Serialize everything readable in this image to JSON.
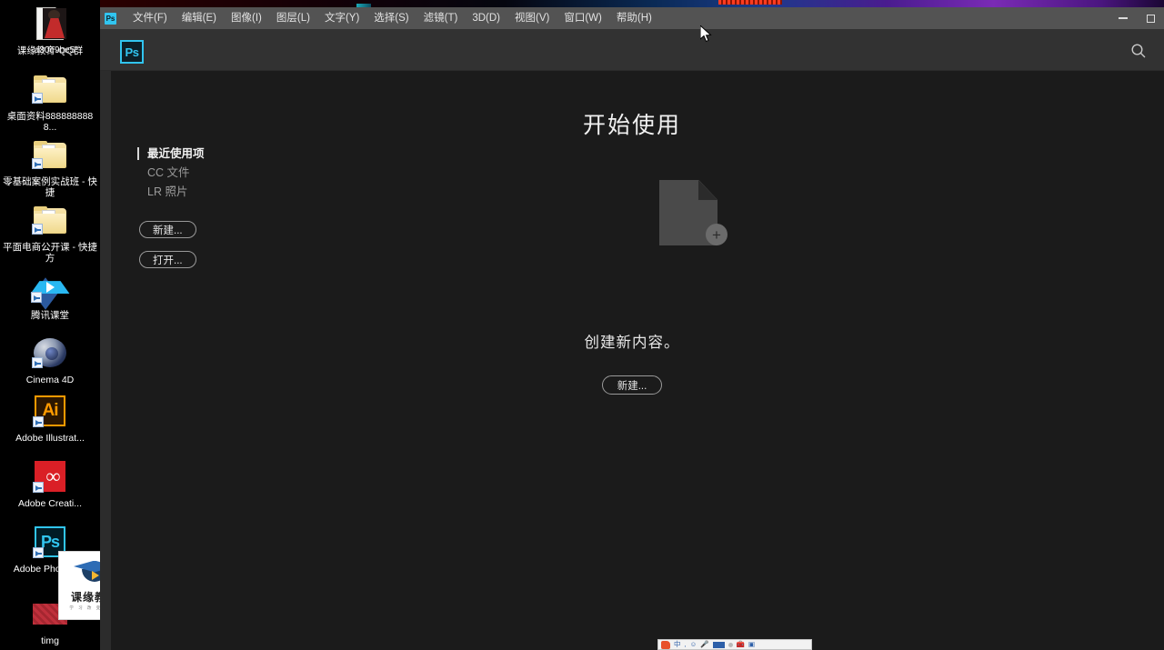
{
  "desktop": {
    "icons": [
      {
        "label": "课缘教育-QQ群",
        "icon": "document-icon",
        "shortcut": false
      },
      {
        "label": "a30e9be5",
        "icon": "photo-thumbnail-icon",
        "shortcut": false
      },
      {
        "label": "桌面资料8888888888...",
        "icon": "folder-icon",
        "shortcut": true
      },
      {
        "label": "零基础案例实战班 - 快捷",
        "icon": "folder-icon",
        "shortcut": true
      },
      {
        "label": "平面电商公开课 - 快捷方",
        "icon": "folder-icon",
        "shortcut": true
      },
      {
        "label": "腾讯课堂",
        "icon": "tencent-classroom-icon",
        "shortcut": true
      },
      {
        "label": "Cinema 4D",
        "icon": "cinema4d-icon",
        "shortcut": true
      },
      {
        "label": "Adobe Illustrat...",
        "icon": "adobe-illustrator-icon",
        "shortcut": true
      },
      {
        "label": "Adobe Creati...",
        "icon": "adobe-creative-cloud-icon",
        "shortcut": true
      },
      {
        "label": "Adobe Photosh...",
        "icon": "adobe-photoshop-icon",
        "shortcut": true
      },
      {
        "label": "timg",
        "icon": "image-thumbnail-icon",
        "shortcut": false
      }
    ],
    "watermark": {
      "title": "课缘教育",
      "subtitle": "学 习 改 变 未 来"
    }
  },
  "photoshop": {
    "app_logo": "Ps",
    "menubar": {
      "items": [
        "文件(F)",
        "编辑(E)",
        "图像(I)",
        "图层(L)",
        "文字(Y)",
        "选择(S)",
        "滤镜(T)",
        "3D(D)",
        "视图(V)",
        "窗口(W)",
        "帮助(H)"
      ],
      "window_controls": {
        "minimize": "—",
        "maximize": "□"
      }
    },
    "header": {
      "search_icon": "search-icon"
    },
    "start_screen": {
      "title": "开始使用",
      "recent_tabs": [
        {
          "label": "最近使用项",
          "active": true
        },
        {
          "label": "CC 文件",
          "active": false
        },
        {
          "label": "LR 照片",
          "active": false
        }
      ],
      "left_buttons": [
        {
          "label": "新建..."
        },
        {
          "label": "打开..."
        }
      ],
      "empty_state": {
        "icon": "new-document-icon",
        "plus_glyph": "+",
        "message": "创建新内容。",
        "cta_label": "新建..."
      }
    }
  },
  "taskbar": {
    "ime": {
      "items": [
        "sogou-logo-icon",
        "中",
        "comma-icon",
        "smiley-icon",
        "microphone-icon",
        "keyboard-icon",
        "dot-icon",
        "toolbox-icon",
        "panel-icon"
      ]
    }
  },
  "colors": {
    "accent": "#31c5f0",
    "menubar_bg": "#535353",
    "header_bg": "#323232",
    "workspace_bg": "#1b1b1b"
  }
}
